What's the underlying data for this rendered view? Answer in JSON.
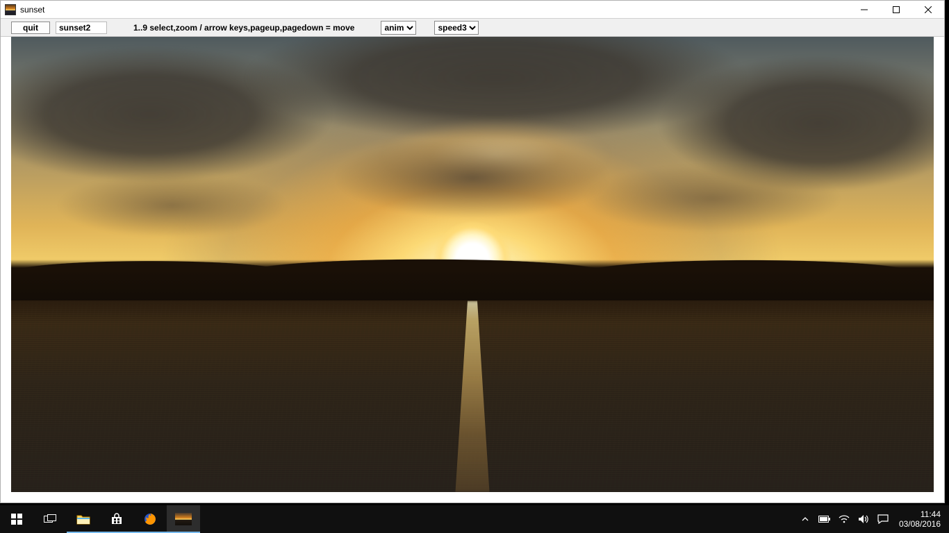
{
  "window": {
    "title": "sunset"
  },
  "toolbar": {
    "quit_label": "quit",
    "filename": "sunset2",
    "help_text": "1..9 select,zoom / arrow keys,pageup,pagedown = move",
    "anim_select": "anim",
    "speed_select": "speed3"
  },
  "taskbar": {
    "time": "11:44",
    "date": "03/08/2016"
  }
}
